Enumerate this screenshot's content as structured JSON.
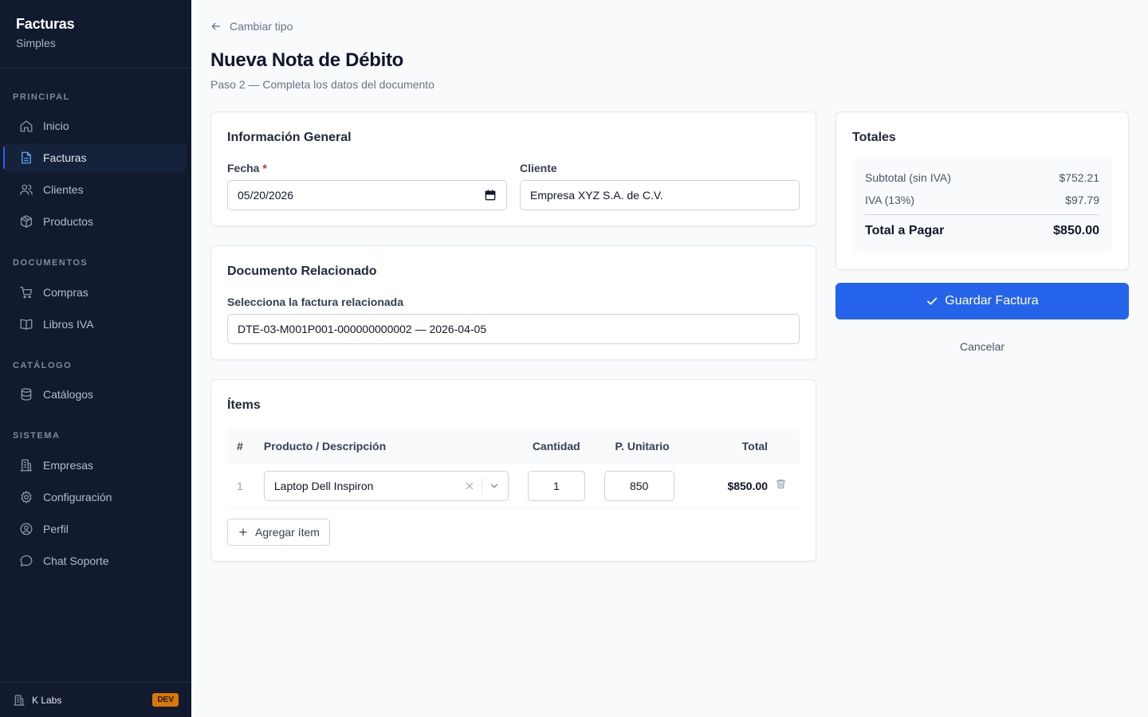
{
  "app": {
    "title": "Facturas",
    "subtitle": "Simples"
  },
  "sidebar": {
    "sections": {
      "principal": "PRINCIPAL",
      "documentos": "DOCUMENTOS",
      "catalogo": "CATÁLOGO",
      "sistema": "SISTEMA"
    },
    "items": [
      {
        "label": "Inicio",
        "icon": "home-icon",
        "active": false
      },
      {
        "label": "Facturas",
        "icon": "document-icon",
        "active": true
      },
      {
        "label": "Clientes",
        "icon": "users-icon",
        "active": false
      },
      {
        "label": "Productos",
        "icon": "box-icon",
        "active": false
      },
      {
        "label": "Compras",
        "icon": "cart-icon",
        "active": false
      },
      {
        "label": "Libros IVA",
        "icon": "book-icon",
        "active": false
      },
      {
        "label": "Catálogos",
        "icon": "database-icon",
        "active": false
      },
      {
        "label": "Empresas",
        "icon": "building-icon",
        "active": false
      },
      {
        "label": "Configuración",
        "icon": "gear-icon",
        "active": false
      },
      {
        "label": "Perfil",
        "icon": "user-circle-icon",
        "active": false
      },
      {
        "label": "Chat Soporte",
        "icon": "chat-icon",
        "active": false
      }
    ],
    "footer": {
      "company": "K Labs",
      "badge": "DEV"
    }
  },
  "header": {
    "back_label": "Cambiar tipo",
    "title": "Nueva Nota de Débito",
    "subtitle": "Paso 2 — Completa los datos del documento"
  },
  "general": {
    "title": "Información General",
    "date_label": "Fecha",
    "required_mark": "*",
    "date_value": "05/20/2026",
    "client_label": "Cliente",
    "client_value": "Empresa XYZ S.A. de C.V."
  },
  "related": {
    "title": "Documento Relacionado",
    "label": "Selecciona la factura relacionada",
    "value": "DTE-03-M001P001-000000000002 — 2026-04-05"
  },
  "items": {
    "title": "Ítems",
    "columns": [
      "#",
      "Producto / Descripción",
      "Cantidad",
      "P. Unitario",
      "Total"
    ],
    "rows": [
      {
        "index": "1",
        "product": "Laptop Dell Inspiron",
        "quantity": "1",
        "unit_price": "850",
        "total": "$850.00"
      }
    ],
    "add_label": "Agregar ítem"
  },
  "totals": {
    "title": "Totales",
    "subtotal_label": "Subtotal (sin IVA)",
    "subtotal_value": "$752.21",
    "iva_label": "IVA (13%)",
    "iva_value": "$97.79",
    "total_label": "Total a Pagar",
    "total_value": "$850.00"
  },
  "actions": {
    "save_label": "Guardar Factura",
    "cancel_label": "Cancelar"
  },
  "colors": {
    "sidebar_bg": "#111a2e",
    "accent": "#2563eb",
    "dev_badge": "#d97706",
    "required": "#dc2626"
  }
}
